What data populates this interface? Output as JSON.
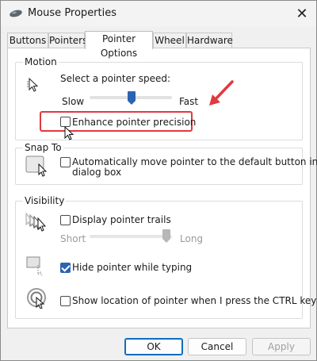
{
  "window": {
    "title": "Mouse Properties",
    "close_glyph": "✕"
  },
  "tabs": [
    {
      "label": "Buttons",
      "active": false
    },
    {
      "label": "Pointers",
      "active": false
    },
    {
      "label": "Pointer Options",
      "active": true
    },
    {
      "label": "Wheel",
      "active": false
    },
    {
      "label": "Hardware",
      "active": false
    }
  ],
  "motion": {
    "group_label": "Motion",
    "speed_label": "Select a pointer speed:",
    "slow_label": "Slow",
    "fast_label": "Fast",
    "speed_value": 0.5,
    "enhance_precision_label": "Enhance pointer precision",
    "enhance_precision_checked": false,
    "highlight_color": "#e0393f"
  },
  "snap_to": {
    "group_label": "Snap To",
    "auto_move_label_line1": "Automatically move pointer to the default button in a",
    "auto_move_label_line2": "dialog box",
    "auto_move_checked": false
  },
  "visibility": {
    "group_label": "Visibility",
    "trails_label": "Display pointer trails",
    "trails_checked": false,
    "short_label": "Short",
    "long_label": "Long",
    "trail_length_value": 1.0,
    "hide_typing_label": "Hide pointer while typing",
    "hide_typing_checked": true,
    "show_location_label": "Show location of pointer when I press the CTRL key",
    "show_location_checked": false
  },
  "buttons": {
    "ok": "OK",
    "cancel": "Cancel",
    "apply": "Apply"
  },
  "colors": {
    "accent": "#2b64b3",
    "arrow": "#e0393f"
  }
}
